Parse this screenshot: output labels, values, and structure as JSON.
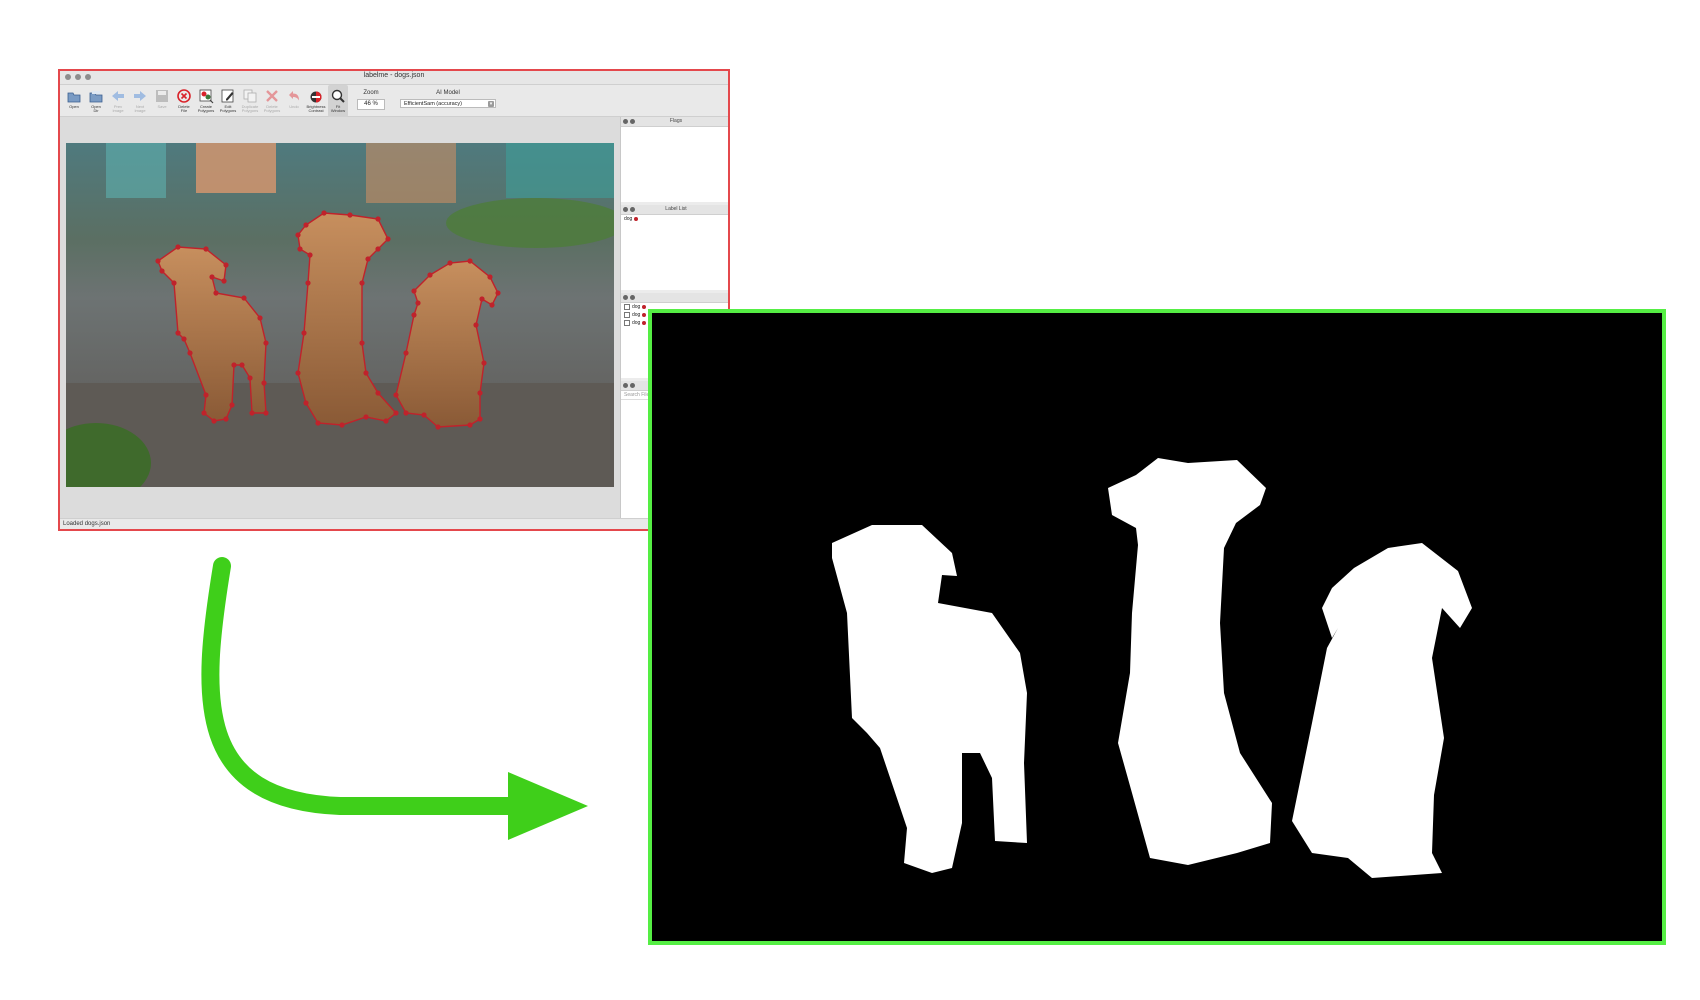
{
  "window": {
    "title": "labelme - dogs.json"
  },
  "toolbar": {
    "tools": [
      {
        "label": "Open",
        "icon": "open-folder-icon",
        "enabled": true
      },
      {
        "label": "Open\nDir",
        "icon": "open-dir-icon",
        "enabled": true
      },
      {
        "label": "Prev\nImage",
        "icon": "arrow-left-icon",
        "enabled": false
      },
      {
        "label": "Next\nImage",
        "icon": "arrow-right-icon",
        "enabled": false
      },
      {
        "label": "Save",
        "icon": "save-icon",
        "enabled": false
      },
      {
        "label": "Delete\nFile",
        "icon": "delete-file-icon",
        "enabled": true
      },
      {
        "label": "Create\nPolygons",
        "icon": "create-polygon-icon",
        "enabled": true
      },
      {
        "label": "Edit\nPolygons",
        "icon": "edit-polygon-icon",
        "enabled": true
      },
      {
        "label": "Duplicate\nPolygons",
        "icon": "duplicate-icon",
        "enabled": false
      },
      {
        "label": "Delete\nPolygons",
        "icon": "delete-polygon-icon",
        "enabled": false
      },
      {
        "label": "Undo",
        "icon": "undo-icon",
        "enabled": false
      },
      {
        "label": "Brightness\nContrast",
        "icon": "brightness-icon",
        "enabled": true
      },
      {
        "label": "Fit\nWindow",
        "icon": "fit-window-icon",
        "enabled": true,
        "active": true
      }
    ],
    "zoom_label": "Zoom",
    "zoom_value": "46 %",
    "ai_model_label": "AI Model",
    "ai_model_value": "EfficientSam (accuracy)"
  },
  "panels": {
    "flags": {
      "title": "Flags"
    },
    "label_list": {
      "title": "Label List",
      "items": [
        {
          "label": "dog",
          "color": "#c0222b"
        }
      ]
    },
    "polygon_labels": {
      "items": [
        "dog",
        "dog",
        "dog"
      ]
    },
    "file_list": {
      "search_placeholder": "Search Filename"
    }
  },
  "status": "Loaded dogs.json",
  "colors": {
    "window_border": "#e4484c",
    "polygon": "#c0222b",
    "mask_border": "#55ee44",
    "arrow": "#3fcf1a"
  }
}
